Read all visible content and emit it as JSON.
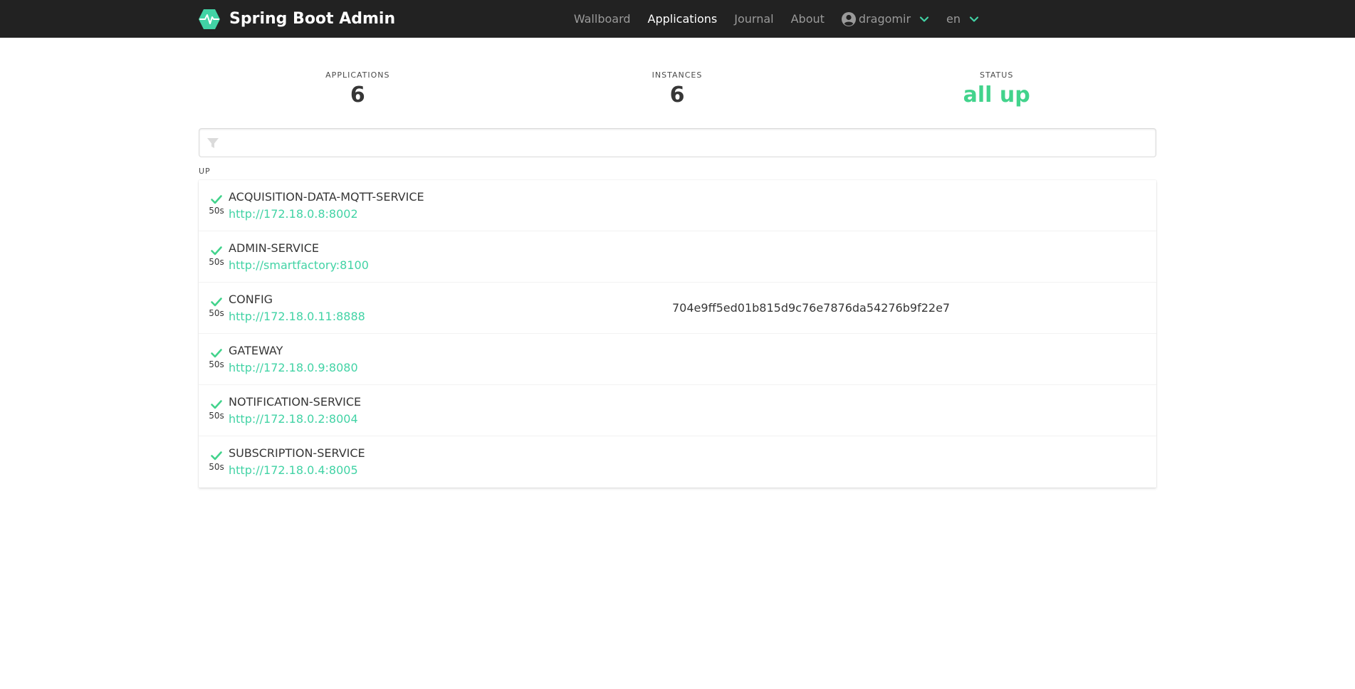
{
  "brand": {
    "title": "Spring Boot Admin",
    "accent_color": "#42d3a5",
    "logo_icon": "heartbeat-hexagon-icon"
  },
  "nav": {
    "items": [
      {
        "label": "Wallboard",
        "active": false
      },
      {
        "label": "Applications",
        "active": true
      },
      {
        "label": "Journal",
        "active": false
      },
      {
        "label": "About",
        "active": false
      }
    ],
    "user": {
      "name": "dragomir",
      "icon": "user-circle-icon"
    },
    "language": {
      "value": "en"
    }
  },
  "stats": {
    "applications": {
      "label": "APPLICATIONS",
      "value": "6"
    },
    "instances": {
      "label": "INSTANCES",
      "value": "6"
    },
    "status": {
      "label": "STATUS",
      "value": "all up",
      "color": "#42d38c"
    }
  },
  "filter": {
    "placeholder": "",
    "value": "",
    "icon": "filter-icon"
  },
  "group": {
    "title": "UP",
    "applications": [
      {
        "name": "ACQUISITION-DATA-MQTT-SERVICE",
        "url": "http://172.18.0.8:8002",
        "since": "50s",
        "version": ""
      },
      {
        "name": "ADMIN-SERVICE",
        "url": "http://smartfactory:8100",
        "since": "50s",
        "version": ""
      },
      {
        "name": "CONFIG",
        "url": "http://172.18.0.11:8888",
        "since": "50s",
        "version": "704e9ff5ed01b815d9c76e7876da54276b9f22e7"
      },
      {
        "name": "GATEWAY",
        "url": "http://172.18.0.9:8080",
        "since": "50s",
        "version": ""
      },
      {
        "name": "NOTIFICATION-SERVICE",
        "url": "http://172.18.0.2:8004",
        "since": "50s",
        "version": ""
      },
      {
        "name": "SUBSCRIPTION-SERVICE",
        "url": "http://172.18.0.4:8005",
        "since": "50s",
        "version": ""
      }
    ]
  }
}
